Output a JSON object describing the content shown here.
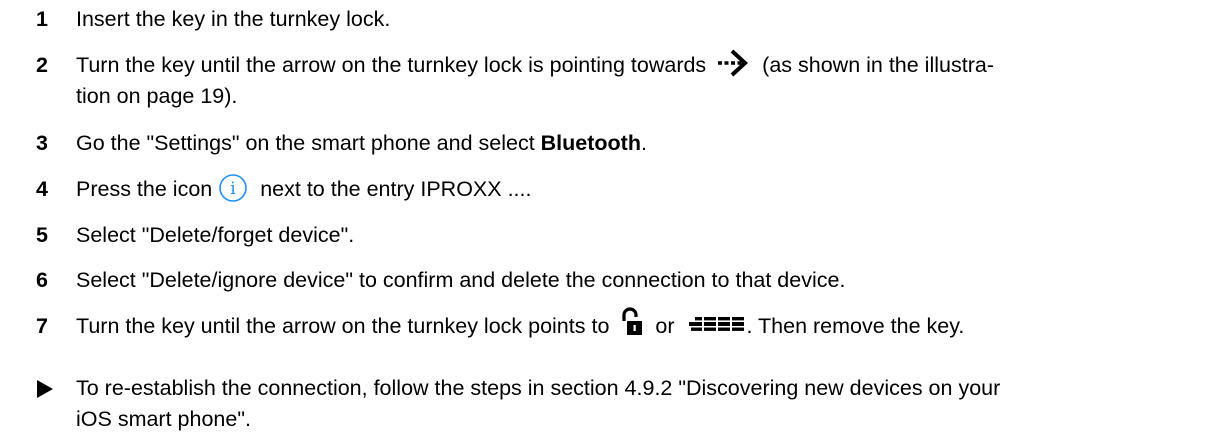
{
  "steps": [
    {
      "num": "1",
      "text": "Insert the key in the turnkey lock."
    },
    {
      "num": "2",
      "text_before_icon": "Turn the key until the arrow on the turnkey lock is pointing towards",
      "text_after_icon": "(as shown in the illustra-",
      "line2": "tion on page 19).",
      "icon": "arrow-right-icon"
    },
    {
      "num": "3",
      "text_before": "Go the \"Settings\" on the smart phone and select ",
      "bold": "Bluetooth",
      "text_after": "."
    },
    {
      "num": "4",
      "text_before_icon": "Press the icon",
      "text_after_icon": "next to the entry IPROXX ....",
      "icon": "info-icon",
      "icon_color": "#1e90ff"
    },
    {
      "num": "5",
      "text": "Select \"Delete/forget device\"."
    },
    {
      "num": "6",
      "text": "Select \"Delete/ignore device\" to confirm and delete the connection to that device."
    },
    {
      "num": "7",
      "text_before_icon": "Turn the key until the arrow on the turnkey lock points to",
      "text_between_icons": "or",
      "text_after_icons": ". Then remove the key.",
      "icons": [
        "padlock-open-icon",
        "dashed-bar-icon"
      ]
    }
  ],
  "note": {
    "icon": "triangle-bullet-icon",
    "line1": "To re-establish the connection, follow the steps in section 4.9.2 \"Discovering new devices on your",
    "line2": "iOS smart phone\"."
  }
}
